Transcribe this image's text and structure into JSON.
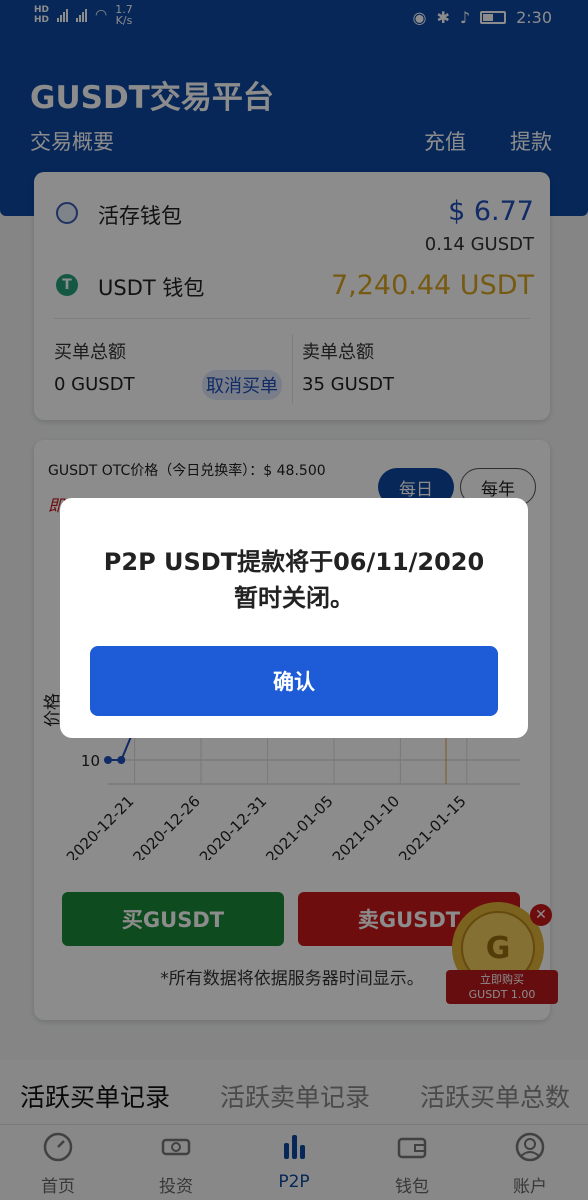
{
  "status_bar": {
    "net_speed": "1.7",
    "net_unit": "K/s",
    "time": "2:30",
    "hd1": "HD",
    "hd2": "HD"
  },
  "header": {
    "title": "GUSDT交易平台",
    "subtitle": "交易概要",
    "action_deposit": "充值",
    "action_withdraw": "提款"
  },
  "wallets": {
    "demand": {
      "label": "活存钱包",
      "usd_value": "$ 6.77",
      "gusdt_value": "0.14 GUSDT"
    },
    "usdt": {
      "label": "USDT 钱包",
      "value": "7,240.44 USDT"
    }
  },
  "orders": {
    "buy_total_label": "买单总额",
    "buy_total_value": "0 GUSDT",
    "cancel_buy_label": "取消买单",
    "sell_total_label": "卖单总额",
    "sell_total_value": "35 GUSDT"
  },
  "price_card": {
    "otc_label": "GUSDT OTC价格（今日兑换率）：",
    "otc_value": "$ 48.500",
    "daily_label": "每日",
    "yearly_label": "每年",
    "note_partial": "即"
  },
  "chart_data": {
    "type": "line",
    "ylabel": "价格",
    "y_ticks": [
      "10"
    ],
    "x_ticks": [
      "2020-12-21",
      "2020-12-26",
      "2020-12-31",
      "2021-01-05",
      "2021-01-10",
      "2021-01-15"
    ],
    "points_visible": [
      {
        "x": "2020-12-19",
        "y": 10
      },
      {
        "x": "2020-12-20",
        "y": 10
      },
      {
        "x": "2020-12-21",
        "y": 14
      },
      {
        "x": "2020-12-22",
        "y": 14
      },
      {
        "x": "2020-12-23",
        "y": 14
      }
    ]
  },
  "buttons": {
    "buy": "买GUSDT",
    "sell": "卖GUSDT"
  },
  "disclaimer": "*所有数据将依据服务器时间显示。",
  "promo": {
    "line1": "立即购买",
    "line2": "GUSDT 1.00"
  },
  "tabs": [
    "活跃买单记录",
    "活跃卖单记录",
    "活跃买单总数"
  ],
  "nav": [
    {
      "label": "首页",
      "icon": "gauge-icon"
    },
    {
      "label": "投资",
      "icon": "money-icon"
    },
    {
      "label": "P2P",
      "icon": "bar-chart-icon"
    },
    {
      "label": "钱包",
      "icon": "wallet-icon"
    },
    {
      "label": "账户",
      "icon": "user-icon"
    }
  ],
  "dialog": {
    "line1": "P2P USDT提款将于06/11/2020",
    "line2": "暂时关闭。",
    "confirm": "确认"
  },
  "colors": {
    "primary": "#0d47a1",
    "buy": "#1b8a3a",
    "sell": "#c8191a",
    "usdt_amount": "#d9a520",
    "dialog_btn": "#1e5bd6"
  }
}
